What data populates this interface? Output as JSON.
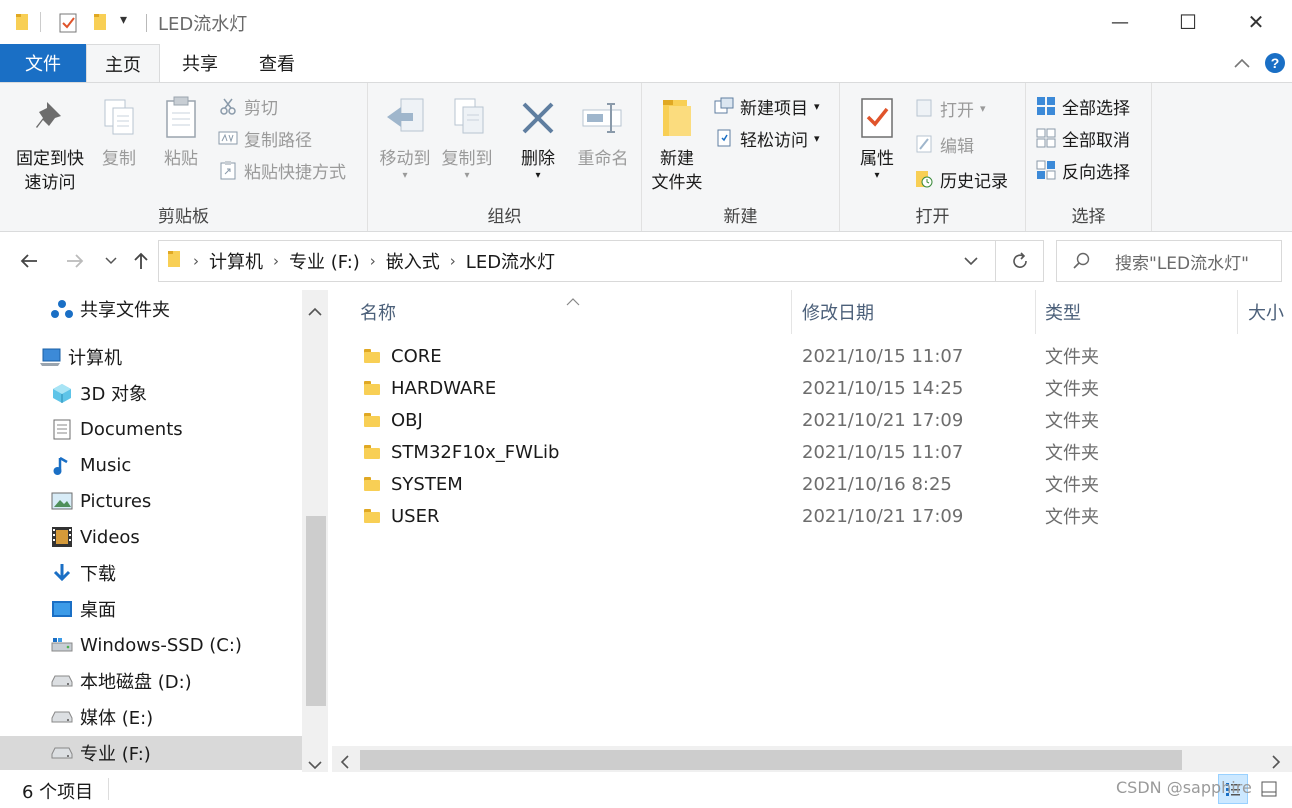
{
  "window": {
    "title": "LED流水灯",
    "quick_access_dropdown": "▾",
    "minimize_glyph": "—",
    "maximize_glyph": "☐",
    "close_glyph": "✕"
  },
  "tabs": {
    "file": "文件",
    "home": "主页",
    "share": "共享",
    "view": "查看"
  },
  "ribbon": {
    "clipboard": {
      "label": "剪贴板",
      "pin_line1": "固定到快",
      "pin_line2": "速访问",
      "copy": "复制",
      "paste": "粘贴",
      "cut": "剪切",
      "copy_path": "复制路径",
      "paste_shortcut": "粘贴快捷方式"
    },
    "organize": {
      "label": "组织",
      "move_to": "移动到",
      "copy_to": "复制到",
      "delete": "删除",
      "rename": "重命名"
    },
    "new": {
      "label": "新建",
      "new_folder_line1": "新建",
      "new_folder_line2": "文件夹",
      "new_item": "新建项目",
      "easy_access": "轻松访问"
    },
    "open": {
      "label": "打开",
      "properties": "属性",
      "open": "打开",
      "edit": "编辑",
      "history": "历史记录"
    },
    "select": {
      "label": "选择",
      "select_all": "全部选择",
      "select_none": "全部取消",
      "invert": "反向选择"
    }
  },
  "address": {
    "crumbs": [
      "计算机",
      "专业 (F:)",
      "嵌入式",
      "LED流水灯"
    ],
    "search_placeholder": "搜索\"LED流水灯\""
  },
  "nav": {
    "items": [
      {
        "label": "共享文件夹",
        "icon": "share-icon"
      },
      {
        "label": "计算机",
        "icon": "computer-icon"
      },
      {
        "label": "3D 对象",
        "icon": "3d-objects-icon"
      },
      {
        "label": "Documents",
        "icon": "documents-icon"
      },
      {
        "label": "Music",
        "icon": "music-icon"
      },
      {
        "label": "Pictures",
        "icon": "pictures-icon"
      },
      {
        "label": "Videos",
        "icon": "videos-icon"
      },
      {
        "label": "下载",
        "icon": "download-icon"
      },
      {
        "label": "桌面",
        "icon": "desktop-icon"
      },
      {
        "label": "Windows-SSD (C:)",
        "icon": "drive-icon"
      },
      {
        "label": "本地磁盘 (D:)",
        "icon": "drive-icon"
      },
      {
        "label": "媒体 (E:)",
        "icon": "drive-icon"
      },
      {
        "label": "专业 (F:)",
        "icon": "drive-icon"
      }
    ]
  },
  "columns": {
    "name": "名称",
    "date": "修改日期",
    "type": "类型",
    "size": "大小"
  },
  "files": [
    {
      "name": "CORE",
      "date": "2021/10/15 11:07",
      "type": "文件夹"
    },
    {
      "name": "HARDWARE",
      "date": "2021/10/15 14:25",
      "type": "文件夹"
    },
    {
      "name": "OBJ",
      "date": "2021/10/21 17:09",
      "type": "文件夹"
    },
    {
      "name": "STM32F10x_FWLib",
      "date": "2021/10/15 11:07",
      "type": "文件夹"
    },
    {
      "name": "SYSTEM",
      "date": "2021/10/16 8:25",
      "type": "文件夹"
    },
    {
      "name": "USER",
      "date": "2021/10/21 17:09",
      "type": "文件夹"
    }
  ],
  "status": {
    "item_count": "6 个项目",
    "watermark": "CSDN @sapphire"
  },
  "colors": {
    "file_tab": "#1a6fc5",
    "folder": "#f8cf55",
    "accent_blue": "#1a6fc5"
  }
}
